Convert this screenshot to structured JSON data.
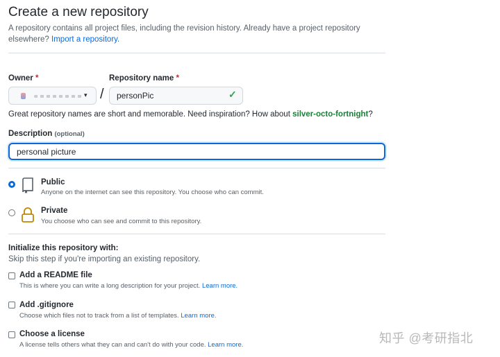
{
  "header": {
    "title": "Create a new repository",
    "subtitle_text": "A repository contains all project files, including the revision history. Already have a project repository elsewhere?",
    "import_link": "Import a repository."
  },
  "owner": {
    "label": "Owner",
    "required_mark": "*",
    "caret": "▾"
  },
  "separator": "/",
  "repo_name": {
    "label": "Repository name",
    "required_mark": "*",
    "value": "personPic"
  },
  "inspiration": {
    "text": "Great repository names are short and memorable. Need inspiration? How about",
    "suggestion": "silver-octo-fortnight",
    "suffix": "?"
  },
  "description": {
    "label": "Description",
    "optional": "(optional)",
    "value": "personal picture"
  },
  "visibility": {
    "public": {
      "title": "Public",
      "desc": "Anyone on the internet can see this repository. You choose who can commit.",
      "icon": "repo-icon"
    },
    "private": {
      "title": "Private",
      "desc": "You choose who can see and commit to this repository.",
      "icon": "lock-icon"
    }
  },
  "initialize": {
    "title": "Initialize this repository with:",
    "subtitle": "Skip this step if you're importing an existing repository.",
    "options": [
      {
        "title": "Add a README file",
        "desc": "This is where you can write a long description for your project.",
        "link": "Learn more."
      },
      {
        "title": "Add .gitignore",
        "desc": "Choose which files not to track from a list of templates.",
        "link": "Learn more."
      },
      {
        "title": "Choose a license",
        "desc": "A license tells others what they can and can't do with your code.",
        "link": "Learn more."
      }
    ]
  },
  "watermark": "知乎 @考研指北",
  "colors": {
    "accent": "#0969da",
    "success": "#2da44e",
    "required": "#cf222e"
  }
}
